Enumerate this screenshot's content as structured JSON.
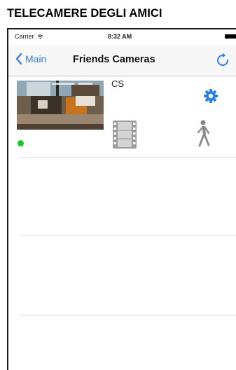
{
  "page_heading": "TELECAMERE DEGLI AMICI",
  "status_bar": {
    "carrier": "Carrier",
    "time": "8:32 AM"
  },
  "nav": {
    "back_label": "Main",
    "title": "Friends Cameras"
  },
  "cameras": [
    {
      "name": "CS",
      "status": "online"
    }
  ],
  "colors": {
    "accent": "#2b7ee8",
    "online": "#1ec729"
  }
}
